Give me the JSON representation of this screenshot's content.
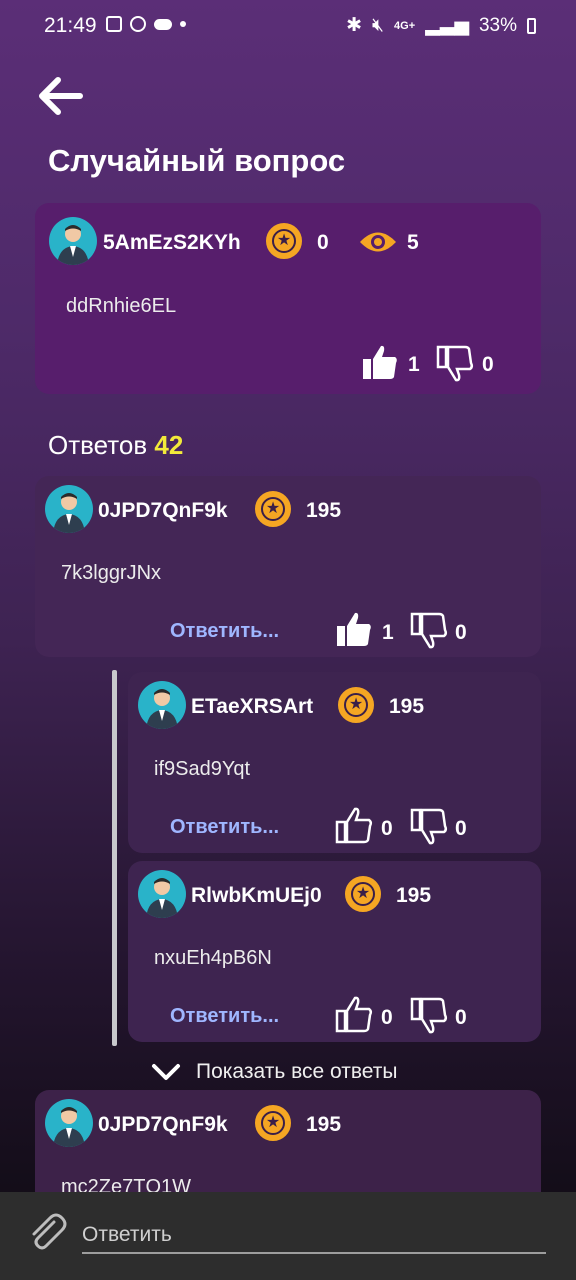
{
  "status_bar": {
    "time": "21:49",
    "battery": "33%",
    "network": "4G+"
  },
  "page": {
    "title": "Случайный вопрос"
  },
  "question": {
    "author": "5AmEzS2KYh",
    "stars": "0",
    "views": "5",
    "text": "ddRnhie6EL",
    "likes": "1",
    "dislikes": "0"
  },
  "answers_header": {
    "label": "Ответов",
    "count": "42"
  },
  "answers": [
    {
      "author": "0JPD7QnF9k",
      "stars": "195",
      "text": "7k3lggrJNx",
      "reply_label": "Ответить...",
      "likes": "1",
      "dislikes": "0",
      "replies": [
        {
          "author": "ETaeXRSArt",
          "stars": "195",
          "text": "if9Sad9Yqt",
          "reply_label": "Ответить...",
          "likes": "0",
          "dislikes": "0"
        },
        {
          "author": "RlwbKmUEj0",
          "stars": "195",
          "text": "nxuEh4pB6N",
          "reply_label": "Ответить...",
          "likes": "0",
          "dislikes": "0"
        }
      ]
    },
    {
      "author": "0JPD7QnF9k",
      "stars": "195",
      "text": "mc2Ze7TQ1W"
    }
  ],
  "show_all_label": "Показать все ответы",
  "reply_bar": {
    "placeholder": "Ответить"
  },
  "colors": {
    "accent_star": "#f5a623",
    "count_yellow": "#f2ea3a",
    "link_blue": "#9fb6ff"
  }
}
